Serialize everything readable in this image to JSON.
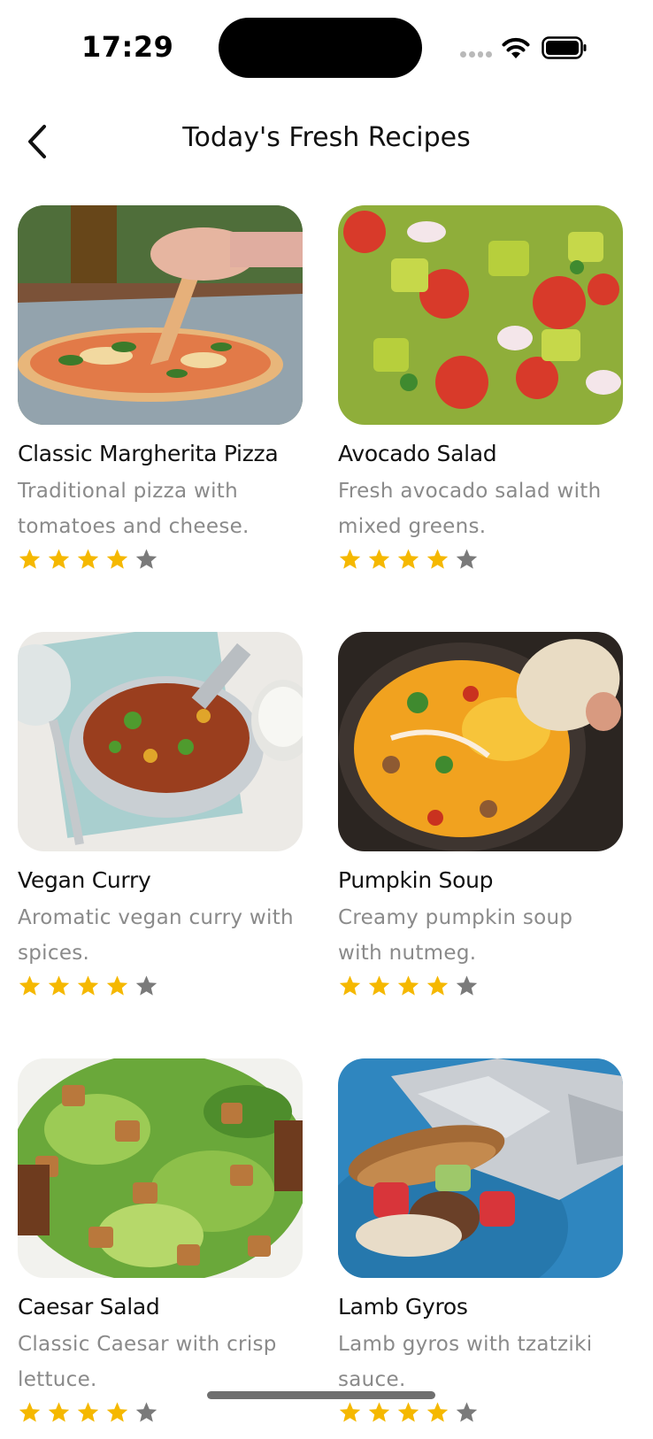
{
  "status_bar": {
    "time": "17:29",
    "wifi_icon": "wifi-icon",
    "battery_icon": "battery-icon"
  },
  "nav": {
    "back_icon": "chevron-left-icon",
    "title": "Today's Fresh Recipes"
  },
  "colors": {
    "star_filled": "#F5B800",
    "star_empty": "#7A7A7A",
    "description_text": "#8A8A8A"
  },
  "recipes": [
    {
      "title": "Classic Margherita Pizza",
      "description": "Traditional pizza with tomatoes and cheese.",
      "rating": 4,
      "rating_max": 5,
      "image": "pizza-photo"
    },
    {
      "title": "Avocado Salad",
      "description": "Fresh avocado salad with mixed greens.",
      "rating": 4,
      "rating_max": 5,
      "image": "avocado-salad-photo"
    },
    {
      "title": "Vegan Curry",
      "description": "Aromatic vegan curry with spices.",
      "rating": 4,
      "rating_max": 5,
      "image": "vegan-curry-photo"
    },
    {
      "title": "Pumpkin Soup",
      "description": "Creamy pumpkin soup with nutmeg.",
      "rating": 4,
      "rating_max": 5,
      "image": "pumpkin-soup-photo"
    },
    {
      "title": "Caesar Salad",
      "description": "Classic Caesar with crisp lettuce.",
      "rating": 4,
      "rating_max": 5,
      "image": "caesar-salad-photo"
    },
    {
      "title": "Lamb Gyros",
      "description": "Lamb gyros with tzatziki sauce.",
      "rating": 4,
      "rating_max": 5,
      "image": "lamb-gyros-photo"
    }
  ]
}
